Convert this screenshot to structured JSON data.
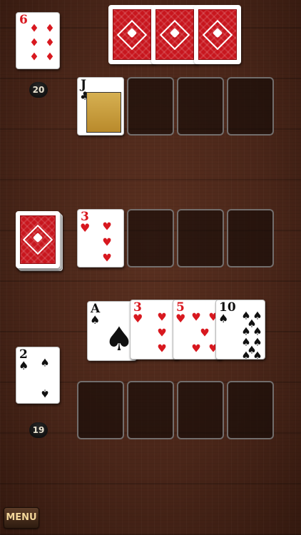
{
  "opponent": {
    "hand_card": {
      "rank": "6",
      "suit": "diamonds",
      "symbol": "♦",
      "color": "red"
    },
    "score": "20",
    "face_down_cards": 3,
    "row": [
      {
        "rank": "J",
        "suit": "clubs",
        "symbol": "♣",
        "color": "black"
      },
      null,
      null,
      null
    ]
  },
  "middle": {
    "deck_back": true,
    "row": [
      {
        "rank": "3",
        "suit": "hearts",
        "symbol": "♥",
        "color": "red"
      },
      null,
      null,
      null
    ]
  },
  "player": {
    "hand_fan": [
      {
        "rank": "A",
        "suit": "spades",
        "symbol": "♠",
        "color": "black"
      },
      {
        "rank": "3",
        "suit": "hearts",
        "symbol": "♥",
        "color": "red"
      },
      {
        "rank": "5",
        "suit": "hearts",
        "symbol": "♥",
        "color": "red"
      },
      {
        "rank": "10",
        "suit": "spades",
        "symbol": "♠",
        "color": "black"
      }
    ],
    "current_card": {
      "rank": "2",
      "suit": "spades",
      "symbol": "♠",
      "color": "black"
    },
    "score": "19",
    "row": [
      null,
      null,
      null,
      null
    ]
  },
  "menu_label": "MENU",
  "colors": {
    "card_red": "#d8181f",
    "card_back": "#c8161e",
    "table_wood": "#4a2619"
  }
}
